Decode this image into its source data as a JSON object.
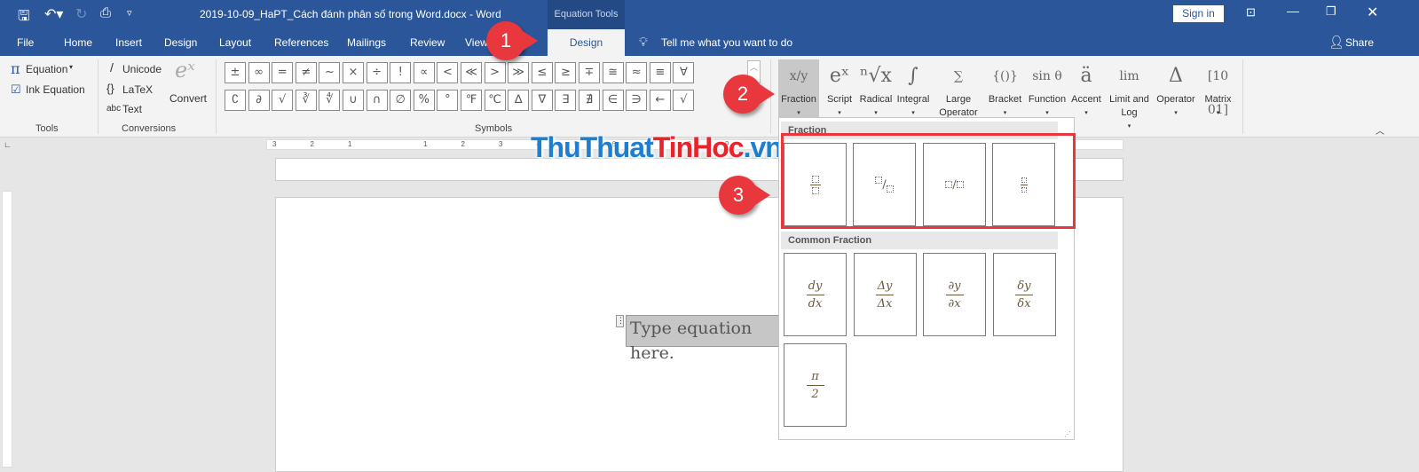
{
  "titlebar": {
    "title": "2019-10-09_HaPT_Cách đánh phân số trong Word.docx  -  Word",
    "context_tab": "Equation Tools",
    "sign_in": "Sign in"
  },
  "tabs": [
    "File",
    "Home",
    "Insert",
    "Design",
    "Layout",
    "References",
    "Mailings",
    "Review",
    "View"
  ],
  "active_tab": "Design",
  "tell_me": "Tell me what you want to do",
  "share": "Share",
  "tools": {
    "equation": "Equation",
    "ink_equation": "Ink Equation",
    "group": "Tools"
  },
  "conversions": {
    "unicode": "Unicode",
    "latex": "LaTeX",
    "text": "Text",
    "convert": "Convert",
    "group": "Conversions"
  },
  "symbols": {
    "group": "Symbols",
    "row1": [
      "±",
      "∞",
      "=",
      "≠",
      "~",
      "×",
      "÷",
      "!",
      "∝",
      "<",
      "≪",
      ">",
      "≫",
      "≤",
      "≥",
      "∓",
      "≅",
      "≈",
      "≡",
      "∀"
    ],
    "row2": [
      "∁",
      "∂",
      "√",
      "∛",
      "∜",
      "∪",
      "∩",
      "∅",
      "%",
      "°",
      "℉",
      "℃",
      "∆",
      "∇",
      "∃",
      "∄",
      "∈",
      "∋",
      "←",
      "√"
    ]
  },
  "structures": [
    {
      "label": "Fraction",
      "glyph": "x/y"
    },
    {
      "label": "Script",
      "glyph": "eˣ"
    },
    {
      "label": "Radical",
      "glyph": "ⁿ√x"
    },
    {
      "label": "Integral",
      "glyph": "∫"
    },
    {
      "label": "Large Operator",
      "glyph": "∑"
    },
    {
      "label": "Bracket",
      "glyph": "{()}"
    },
    {
      "label": "Function",
      "glyph": "sin θ"
    },
    {
      "label": "Accent",
      "glyph": "ä"
    },
    {
      "label": "Limit and Log",
      "glyph": "lim"
    },
    {
      "label": "Operator",
      "glyph": "Δ"
    },
    {
      "label": "Matrix",
      "glyph": "[10 01]"
    }
  ],
  "dropdown": {
    "section1": "Fraction",
    "section2": "Common Fraction",
    "common": [
      [
        "dy",
        "dx"
      ],
      [
        "Δy",
        "Δx"
      ],
      [
        "∂y",
        "∂x"
      ],
      [
        "δy",
        "δx"
      ],
      [
        "π",
        "2"
      ]
    ]
  },
  "document": {
    "placeholder": "Type equation here."
  },
  "watermark": {
    "part1": "ThuThuat",
    "part2": "TinHoc",
    ".vn": ".vn"
  },
  "badges": [
    "1",
    "2",
    "3"
  ],
  "colors": {
    "brand": "#2b579a",
    "badge": "#e8373d",
    "highlight": "#e8373d"
  }
}
